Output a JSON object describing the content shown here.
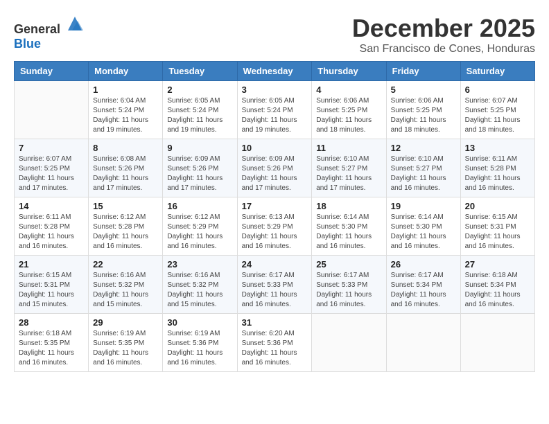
{
  "logo": {
    "general": "General",
    "blue": "Blue"
  },
  "header": {
    "month": "December 2025",
    "location": "San Francisco de Cones, Honduras"
  },
  "weekdays": [
    "Sunday",
    "Monday",
    "Tuesday",
    "Wednesday",
    "Thursday",
    "Friday",
    "Saturday"
  ],
  "weeks": [
    [
      {
        "day": "",
        "sunrise": "",
        "sunset": "",
        "daylight": ""
      },
      {
        "day": "1",
        "sunrise": "Sunrise: 6:04 AM",
        "sunset": "Sunset: 5:24 PM",
        "daylight": "Daylight: 11 hours and 19 minutes."
      },
      {
        "day": "2",
        "sunrise": "Sunrise: 6:05 AM",
        "sunset": "Sunset: 5:24 PM",
        "daylight": "Daylight: 11 hours and 19 minutes."
      },
      {
        "day": "3",
        "sunrise": "Sunrise: 6:05 AM",
        "sunset": "Sunset: 5:24 PM",
        "daylight": "Daylight: 11 hours and 19 minutes."
      },
      {
        "day": "4",
        "sunrise": "Sunrise: 6:06 AM",
        "sunset": "Sunset: 5:25 PM",
        "daylight": "Daylight: 11 hours and 18 minutes."
      },
      {
        "day": "5",
        "sunrise": "Sunrise: 6:06 AM",
        "sunset": "Sunset: 5:25 PM",
        "daylight": "Daylight: 11 hours and 18 minutes."
      },
      {
        "day": "6",
        "sunrise": "Sunrise: 6:07 AM",
        "sunset": "Sunset: 5:25 PM",
        "daylight": "Daylight: 11 hours and 18 minutes."
      }
    ],
    [
      {
        "day": "7",
        "sunrise": "Sunrise: 6:07 AM",
        "sunset": "Sunset: 5:25 PM",
        "daylight": "Daylight: 11 hours and 17 minutes."
      },
      {
        "day": "8",
        "sunrise": "Sunrise: 6:08 AM",
        "sunset": "Sunset: 5:26 PM",
        "daylight": "Daylight: 11 hours and 17 minutes."
      },
      {
        "day": "9",
        "sunrise": "Sunrise: 6:09 AM",
        "sunset": "Sunset: 5:26 PM",
        "daylight": "Daylight: 11 hours and 17 minutes."
      },
      {
        "day": "10",
        "sunrise": "Sunrise: 6:09 AM",
        "sunset": "Sunset: 5:26 PM",
        "daylight": "Daylight: 11 hours and 17 minutes."
      },
      {
        "day": "11",
        "sunrise": "Sunrise: 6:10 AM",
        "sunset": "Sunset: 5:27 PM",
        "daylight": "Daylight: 11 hours and 17 minutes."
      },
      {
        "day": "12",
        "sunrise": "Sunrise: 6:10 AM",
        "sunset": "Sunset: 5:27 PM",
        "daylight": "Daylight: 11 hours and 16 minutes."
      },
      {
        "day": "13",
        "sunrise": "Sunrise: 6:11 AM",
        "sunset": "Sunset: 5:28 PM",
        "daylight": "Daylight: 11 hours and 16 minutes."
      }
    ],
    [
      {
        "day": "14",
        "sunrise": "Sunrise: 6:11 AM",
        "sunset": "Sunset: 5:28 PM",
        "daylight": "Daylight: 11 hours and 16 minutes."
      },
      {
        "day": "15",
        "sunrise": "Sunrise: 6:12 AM",
        "sunset": "Sunset: 5:28 PM",
        "daylight": "Daylight: 11 hours and 16 minutes."
      },
      {
        "day": "16",
        "sunrise": "Sunrise: 6:12 AM",
        "sunset": "Sunset: 5:29 PM",
        "daylight": "Daylight: 11 hours and 16 minutes."
      },
      {
        "day": "17",
        "sunrise": "Sunrise: 6:13 AM",
        "sunset": "Sunset: 5:29 PM",
        "daylight": "Daylight: 11 hours and 16 minutes."
      },
      {
        "day": "18",
        "sunrise": "Sunrise: 6:14 AM",
        "sunset": "Sunset: 5:30 PM",
        "daylight": "Daylight: 11 hours and 16 minutes."
      },
      {
        "day": "19",
        "sunrise": "Sunrise: 6:14 AM",
        "sunset": "Sunset: 5:30 PM",
        "daylight": "Daylight: 11 hours and 16 minutes."
      },
      {
        "day": "20",
        "sunrise": "Sunrise: 6:15 AM",
        "sunset": "Sunset: 5:31 PM",
        "daylight": "Daylight: 11 hours and 16 minutes."
      }
    ],
    [
      {
        "day": "21",
        "sunrise": "Sunrise: 6:15 AM",
        "sunset": "Sunset: 5:31 PM",
        "daylight": "Daylight: 11 hours and 15 minutes."
      },
      {
        "day": "22",
        "sunrise": "Sunrise: 6:16 AM",
        "sunset": "Sunset: 5:32 PM",
        "daylight": "Daylight: 11 hours and 15 minutes."
      },
      {
        "day": "23",
        "sunrise": "Sunrise: 6:16 AM",
        "sunset": "Sunset: 5:32 PM",
        "daylight": "Daylight: 11 hours and 15 minutes."
      },
      {
        "day": "24",
        "sunrise": "Sunrise: 6:17 AM",
        "sunset": "Sunset: 5:33 PM",
        "daylight": "Daylight: 11 hours and 16 minutes."
      },
      {
        "day": "25",
        "sunrise": "Sunrise: 6:17 AM",
        "sunset": "Sunset: 5:33 PM",
        "daylight": "Daylight: 11 hours and 16 minutes."
      },
      {
        "day": "26",
        "sunrise": "Sunrise: 6:17 AM",
        "sunset": "Sunset: 5:34 PM",
        "daylight": "Daylight: 11 hours and 16 minutes."
      },
      {
        "day": "27",
        "sunrise": "Sunrise: 6:18 AM",
        "sunset": "Sunset: 5:34 PM",
        "daylight": "Daylight: 11 hours and 16 minutes."
      }
    ],
    [
      {
        "day": "28",
        "sunrise": "Sunrise: 6:18 AM",
        "sunset": "Sunset: 5:35 PM",
        "daylight": "Daylight: 11 hours and 16 minutes."
      },
      {
        "day": "29",
        "sunrise": "Sunrise: 6:19 AM",
        "sunset": "Sunset: 5:35 PM",
        "daylight": "Daylight: 11 hours and 16 minutes."
      },
      {
        "day": "30",
        "sunrise": "Sunrise: 6:19 AM",
        "sunset": "Sunset: 5:36 PM",
        "daylight": "Daylight: 11 hours and 16 minutes."
      },
      {
        "day": "31",
        "sunrise": "Sunrise: 6:20 AM",
        "sunset": "Sunset: 5:36 PM",
        "daylight": "Daylight: 11 hours and 16 minutes."
      },
      {
        "day": "",
        "sunrise": "",
        "sunset": "",
        "daylight": ""
      },
      {
        "day": "",
        "sunrise": "",
        "sunset": "",
        "daylight": ""
      },
      {
        "day": "",
        "sunrise": "",
        "sunset": "",
        "daylight": ""
      }
    ]
  ]
}
